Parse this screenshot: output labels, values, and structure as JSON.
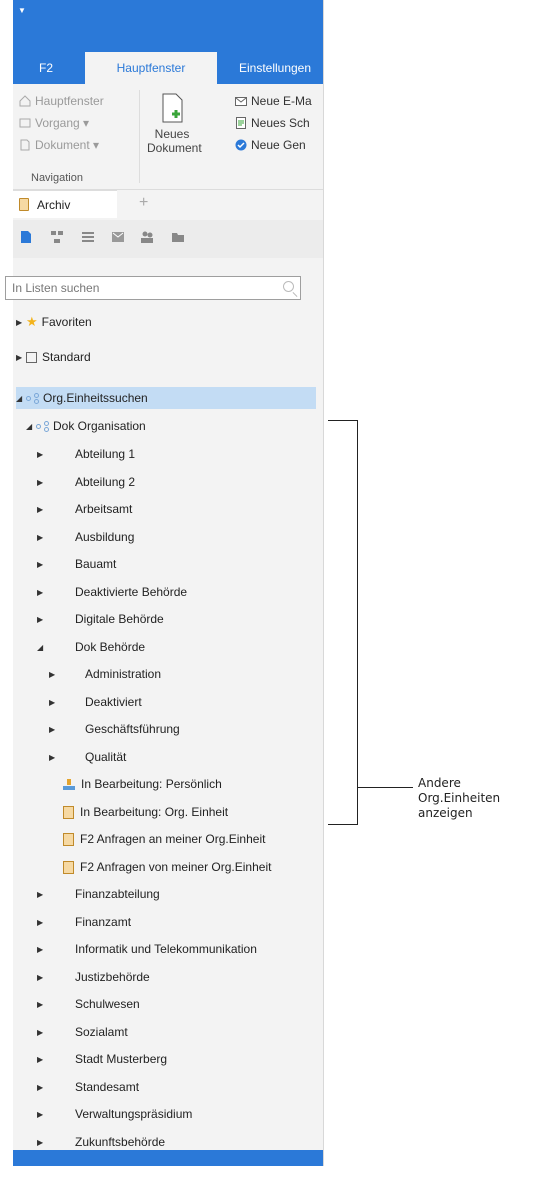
{
  "tabs": [
    "F2",
    "Hauptfenster",
    "Einstellungen"
  ],
  "ribbon": {
    "nav_items": [
      "Hauptfenster",
      "Vorgang ▾",
      "Dokument ▾"
    ],
    "group_label": "Navigation",
    "new_doc_label": "Neues Dokument",
    "right_items": [
      "Neue E-Ma",
      "Neues Sch",
      "Neue Gen"
    ]
  },
  "doc_tab": {
    "label": "Archiv"
  },
  "search": {
    "placeholder": "In Listen suchen"
  },
  "tree": {
    "favoriten": "Favoriten",
    "standard": "Standard",
    "org_search": "Org.Einheitssuchen",
    "dok_org": "Dok Organisation",
    "units_before": [
      "Abteilung 1",
      "Abteilung 2",
      "Arbeitsamt",
      "Ausbildung",
      "Bauamt",
      "Deaktivierte Behörde",
      "Digitale Behörde"
    ],
    "dok_behoerde": "Dok Behörde",
    "sub_units": [
      "Administration",
      "Deaktiviert",
      "Geschäftsführung",
      "Qualität"
    ],
    "queues": [
      "In Bearbeitung: Persönlich",
      "In Bearbeitung: Org. Einheit",
      "F2 Anfragen an meiner Org.Einheit",
      "F2 Anfragen von meiner Org.Einheit"
    ],
    "units_after": [
      "Finanzabteilung",
      "Finanzamt",
      "Informatik und Telekommunikation",
      "Justizbehörde",
      "Schulwesen",
      "Sozialamt",
      "Stadt Musterberg",
      "Standesamt",
      "Verwaltungspräsidium",
      "Zukunftsbehörde"
    ]
  },
  "annotation": [
    "Andere",
    "Org.Einheiten",
    "anzeigen"
  ]
}
